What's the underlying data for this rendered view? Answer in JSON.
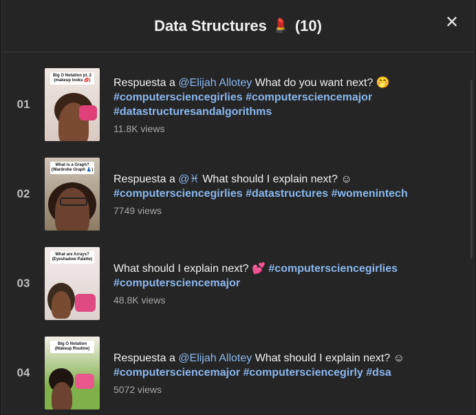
{
  "header": {
    "title": "Data Structures",
    "emoji": "💄",
    "count": "(10)",
    "close_label": "✕"
  },
  "items": [
    {
      "index": "01",
      "thumb_text": "Big O Notation pt. 2 (makeup looks 💋)",
      "caption_prefix": "Respuesta a ",
      "mention": "@Elijah Allotey",
      "caption_text": " What do you want next? 🤭",
      "tags": [
        "#computersciencegirlies",
        "#computersciencemajor",
        "#datastructuresandalgorithms"
      ],
      "views": "11.8K views"
    },
    {
      "index": "02",
      "thumb_text": "What is a Graph? (Wardrobe Graph 👗)",
      "caption_prefix": "Respuesta a ",
      "mention": "@♓",
      "caption_text": " What should I explain next? ☺",
      "tags": [
        "#computersciencegirlies",
        "#datastructures",
        "#womenintech"
      ],
      "views": "7749 views"
    },
    {
      "index": "03",
      "thumb_text": "What are Arrays? (Eyeshadow Palette)",
      "caption_prefix": "",
      "mention": "",
      "caption_text": "What should I explain next? 💕",
      "tags": [
        "#computersciencegirlies",
        "#computersciencemajor"
      ],
      "views": "48.8K views"
    },
    {
      "index": "04",
      "thumb_text": "Big O Notation (Makeup Routine)",
      "caption_prefix": "Respuesta a ",
      "mention": "@Elijah Allotey",
      "caption_text": " What should I explain next? ☺",
      "tags": [
        "#computersciencemajor",
        "#computersciencegirly",
        "#dsa"
      ],
      "views": "5072 views"
    }
  ],
  "colors": {
    "panel_bg": "#252525",
    "hashtag": "#8ab8f0",
    "text": "#f1f1f1",
    "muted": "#a8a8a8"
  }
}
